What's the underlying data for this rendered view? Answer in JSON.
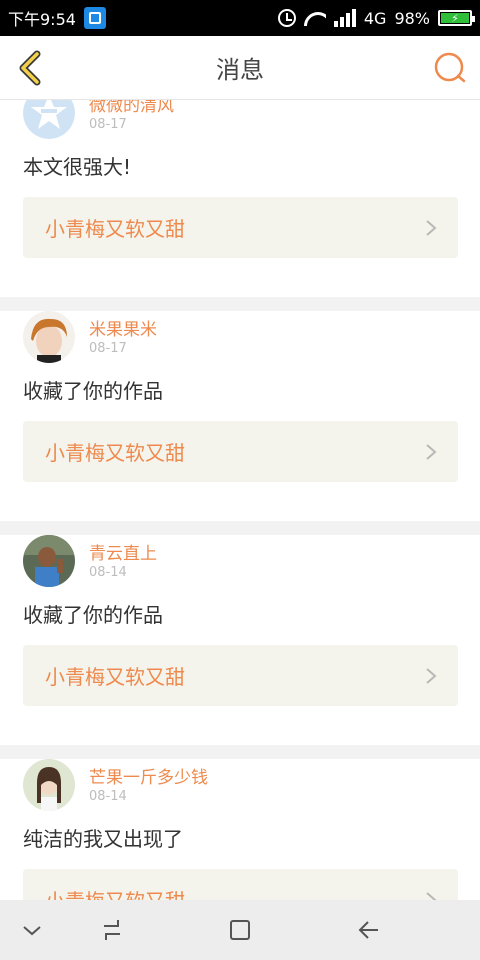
{
  "status_bar": {
    "time": "下午9:54",
    "network": "4G",
    "battery": "98%",
    "battery_color": "#2fbf3a"
  },
  "header": {
    "title": "消息",
    "accent": "#ee8a4e"
  },
  "messages": [
    {
      "user": "微微的清风",
      "date": "08-17",
      "text": "本文很强大!",
      "work": "小青梅又软又甜",
      "avatar": "qzone-logo-avatar"
    },
    {
      "user": "米果果米",
      "date": "08-17",
      "text": "收藏了你的作品",
      "work": "小青梅又软又甜",
      "avatar": "photo-avatar"
    },
    {
      "user": "青云直上",
      "date": "08-14",
      "text": "收藏了你的作品",
      "work": "小青梅又软又甜",
      "avatar": "photo-avatar"
    },
    {
      "user": "芒果一斤多少钱",
      "date": "08-14",
      "text": "纯洁的我又出现了",
      "work": "小青梅又软又甜",
      "avatar": "photo-avatar"
    }
  ],
  "nav_bar": {
    "icons": [
      "chevron-down-icon",
      "recent-apps-icon",
      "home-icon",
      "back-icon"
    ]
  }
}
